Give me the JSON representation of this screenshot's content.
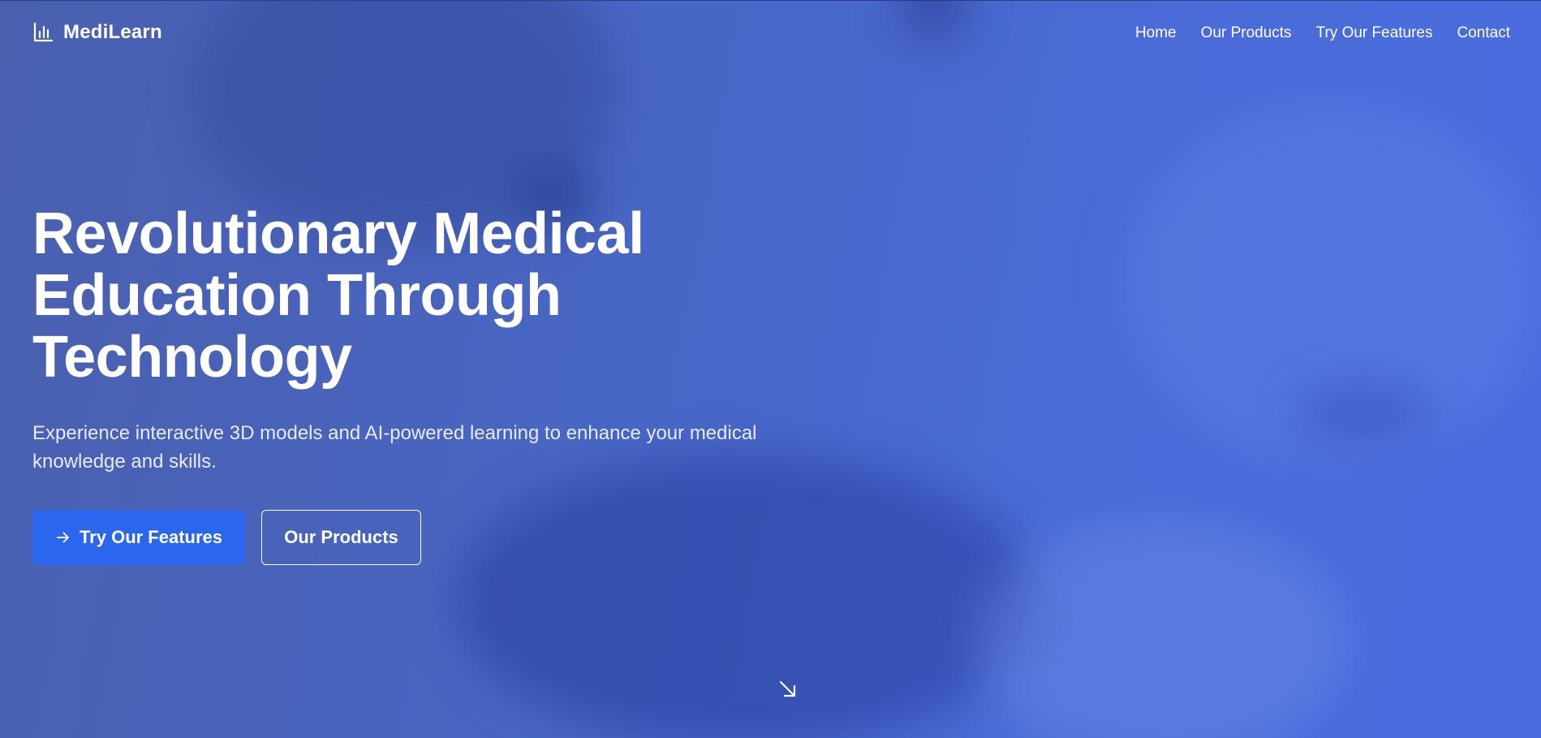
{
  "brand": {
    "name": "MediLearn",
    "icon": "bar-chart-icon"
  },
  "nav": {
    "items": [
      {
        "label": "Home"
      },
      {
        "label": "Our Products"
      },
      {
        "label": "Try Our Features"
      },
      {
        "label": "Contact"
      }
    ]
  },
  "hero": {
    "title_line1": "Revolutionary Medical",
    "title_line2": "Education Through",
    "title_line3": "Technology",
    "subtitle_line1": "Experience interactive 3D models and AI-powered learning to enhance your medical",
    "subtitle_line2": "knowledge and skills.",
    "primary_button": {
      "label": "Try Our Features",
      "icon": "arrow-right-icon"
    },
    "secondary_button": {
      "label": "Our Products"
    },
    "scroll_icon": "arrow-down-right-icon"
  },
  "colors": {
    "background": "#4a64c8",
    "primary_button": "#2b66ee",
    "text": "#ffffff"
  }
}
